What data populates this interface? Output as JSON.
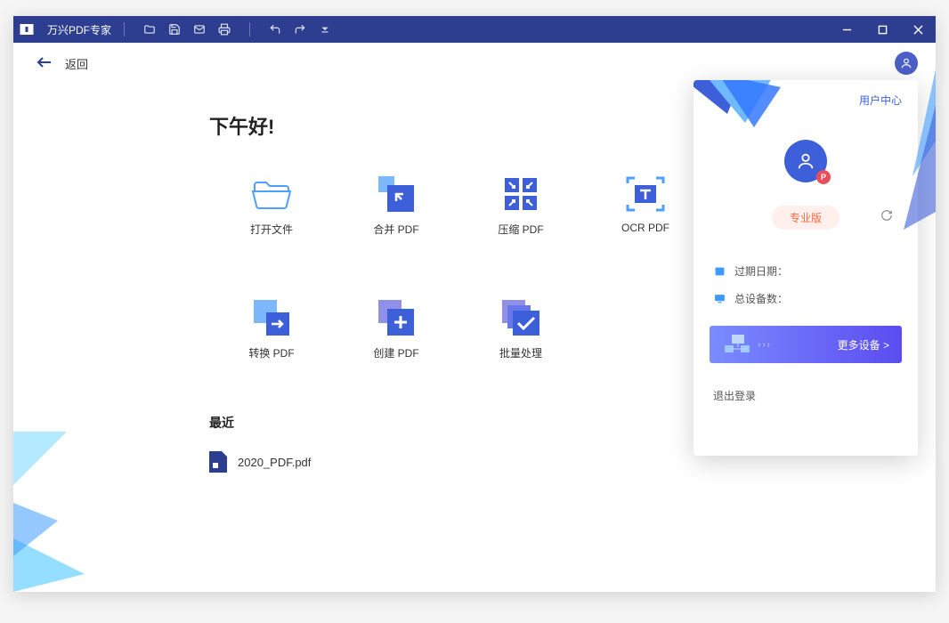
{
  "app_title": "万兴PDF专家",
  "back_label": "返回",
  "greeting": "下午好!",
  "actions": [
    {
      "label": "打开文件"
    },
    {
      "label": "合并 PDF"
    },
    {
      "label": "压缩 PDF"
    },
    {
      "label": "OCR PDF"
    },
    {
      "label": "转换 PDF"
    },
    {
      "label": "创建 PDF"
    },
    {
      "label": "批量处理"
    }
  ],
  "recent": {
    "title": "最近",
    "items": [
      {
        "name": "2020_PDF.pdf"
      }
    ]
  },
  "user_panel": {
    "link": "用户中心",
    "avatar_badge": "P",
    "tag": "专业版",
    "expiry_label": "过期日期：",
    "devices_label": "总设备数：",
    "banner_label": "更多设备 >",
    "logout": "退出登录"
  }
}
